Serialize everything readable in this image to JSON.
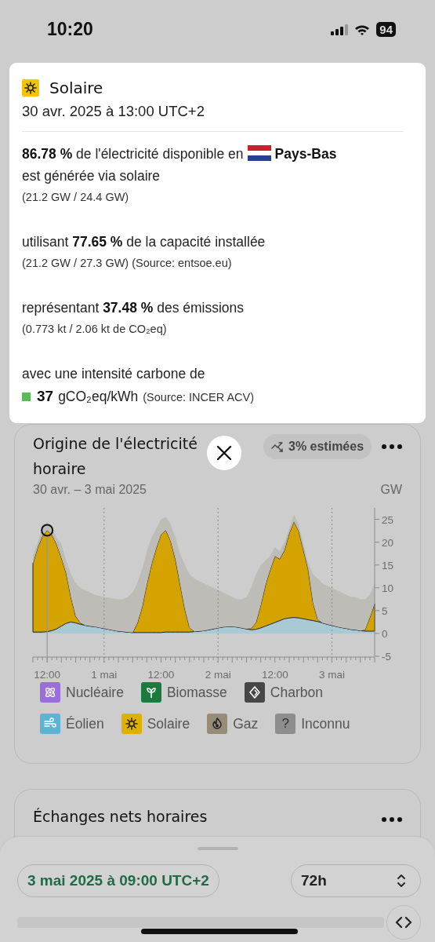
{
  "status_bar": {
    "time": "10:20",
    "battery": "94"
  },
  "tooltip": {
    "source": {
      "kind": "solar",
      "label": "Solaire"
    },
    "datetime": "30 avr. 2025 à 13:00 UTC+2",
    "share": {
      "before": "**86.78 %** de l'électricité disponible en",
      "country": "Pays-Bas",
      "after": "est générée via solaire",
      "detail": "(21.2 GW / 24.4 GW)"
    },
    "capacity": {
      "text": "utilisant **77.65 %** de la capacité installée",
      "detail": "(21.2 GW / 27.3 GW)",
      "source": "(Source: entsoe.eu)"
    },
    "emissions": {
      "text": "représentant **37.48 %** des émissions",
      "detail": "(0.773 kt / 2.06 kt de CO₂eq)"
    },
    "intensity": {
      "text": "avec une intensité carbone de",
      "value": "37",
      "unit": "gCO₂eq/kWh",
      "source": "(Source: INCER ACV)",
      "color": "#5cb85c"
    }
  },
  "production_card": {
    "title": "Origine de l'électricité horaire",
    "date_range": "30 avr. – 3 mai 2025",
    "estimate_badge": "3% estimées",
    "chart_data": {
      "type": "area",
      "ylabel": "GW",
      "stacked": true,
      "categories": [
        null,
        null,
        null,
        "12:00",
        null,
        null,
        null,
        null,
        null,
        null,
        null,
        null,
        null,
        null,
        null,
        "1 mai",
        null,
        null,
        null,
        null,
        null,
        null,
        null,
        null,
        null,
        null,
        null,
        "12:00",
        null,
        null,
        null,
        null,
        null,
        null,
        null,
        null,
        null,
        null,
        null,
        "2 mai",
        null,
        null,
        null,
        null,
        null,
        null,
        null,
        null,
        null,
        null,
        null,
        "12:00",
        null,
        null,
        null,
        null,
        null,
        null,
        null,
        null,
        null,
        null,
        null,
        "3 mai",
        null,
        null,
        null,
        null,
        null,
        null,
        null,
        null,
        null
      ],
      "ylim": [
        -5,
        27.5
      ],
      "yticks": [
        -5,
        0,
        5,
        10,
        15,
        20,
        25
      ],
      "series": [
        {
          "color": "#a9c9d4",
          "values": [
            0.3,
            0.3,
            0.3,
            0.4,
            0.6,
            1,
            1.6,
            2.2,
            2.5,
            2.3,
            2,
            1.8,
            1.6,
            1.5,
            1.3,
            1.1,
            0.9,
            0.7,
            0.5,
            0.4,
            0.3,
            0.2,
            0.2,
            0.2,
            0.2,
            0.2,
            0.2,
            0.2,
            0.3,
            0.3,
            0.3,
            0.3,
            0.3,
            0.3,
            0.4,
            0.5,
            0.6,
            0.8,
            1,
            1.2,
            1.4,
            1.5,
            1.5,
            1.4,
            1.2,
            1,
            0.8,
            0.9,
            1.2,
            1.6,
            2,
            2.4,
            2.8,
            3.2,
            3.4,
            3.5,
            3.4,
            3.2,
            3,
            2.8,
            2.6,
            2.3,
            2,
            1.8,
            1.5,
            1.3,
            1.1,
            0.9,
            0.8,
            0.6,
            0.5,
            0.5,
            0.5
          ]
        },
        {
          "color": "#d4a300",
          "values": [
            15,
            18.5,
            21,
            22.2,
            21,
            18.5,
            15,
            11,
            5.5,
            1.5,
            0.3,
            0,
            0,
            0,
            0,
            0,
            0,
            0,
            0,
            0,
            0,
            0,
            2,
            5.5,
            10.5,
            15,
            18.5,
            21.5,
            22.3,
            20,
            16,
            10.5,
            5,
            1,
            0,
            0,
            0,
            0,
            0,
            0,
            0,
            0,
            0,
            0,
            0,
            0,
            0.3,
            1.5,
            5,
            9,
            12,
            14.5,
            13.5,
            15,
            18.5,
            21,
            19,
            15,
            11,
            4,
            0.5,
            0,
            0,
            0,
            0,
            0,
            0,
            0,
            0,
            0,
            0.3,
            3,
            6
          ]
        },
        {
          "color": "#bebcb7",
          "values": [
            1.7,
            1.2,
            1.7,
            1.9,
            1.4,
            1.5,
            2.9,
            2.8,
            5,
            7.2,
            7.7,
            7.7,
            7.4,
            7,
            6.9,
            6.9,
            6.9,
            6.9,
            7,
            7.1,
            7.7,
            8.8,
            8.8,
            8.3,
            7.3,
            5.8,
            4.3,
            3.3,
            2.9,
            3.7,
            4.7,
            6.7,
            9.7,
            11.7,
            11.6,
            11,
            10.4,
            9.7,
            9,
            8.3,
            7.6,
            7,
            6.5,
            6.1,
            6.3,
            7,
            8.9,
            10.6,
            8.8,
            5.4,
            3,
            2,
            1.7,
            1.8,
            1.1,
            1.5,
            1.5,
            1.5,
            1.5,
            6.2,
            8.9,
            8.7,
            8.5,
            8.2,
            8,
            7.7,
            7.4,
            7.1,
            7.2,
            6.9,
            6.7,
            5,
            4.5
          ]
        }
      ],
      "grid": true,
      "annotations": [
        {
          "x": "12:00"
        }
      ]
    },
    "legend": [
      {
        "kind": "nuclear",
        "label": "Nucléaire",
        "color": "#9a6fd9"
      },
      {
        "kind": "biomass",
        "label": "Biomasse",
        "color": "#1b7a3e"
      },
      {
        "kind": "coal",
        "label": "Charbon",
        "color": "#474747"
      },
      {
        "kind": "wind",
        "label": "Éolien",
        "color": "#5eb3d3"
      },
      {
        "kind": "solar",
        "label": "Solaire",
        "color": "#e0b000"
      },
      {
        "kind": "gas",
        "label": "Gaz",
        "color": "#968c78"
      },
      {
        "kind": "unknown",
        "label": "Inconnu",
        "color": "#8d8d8d",
        "glyph": "?"
      }
    ]
  },
  "exchange_card": {
    "title": "Échanges nets horaires"
  },
  "bottom_sheet": {
    "datetime": "3 mai 2025 à 09:00 UTC+2",
    "range": "72h"
  }
}
